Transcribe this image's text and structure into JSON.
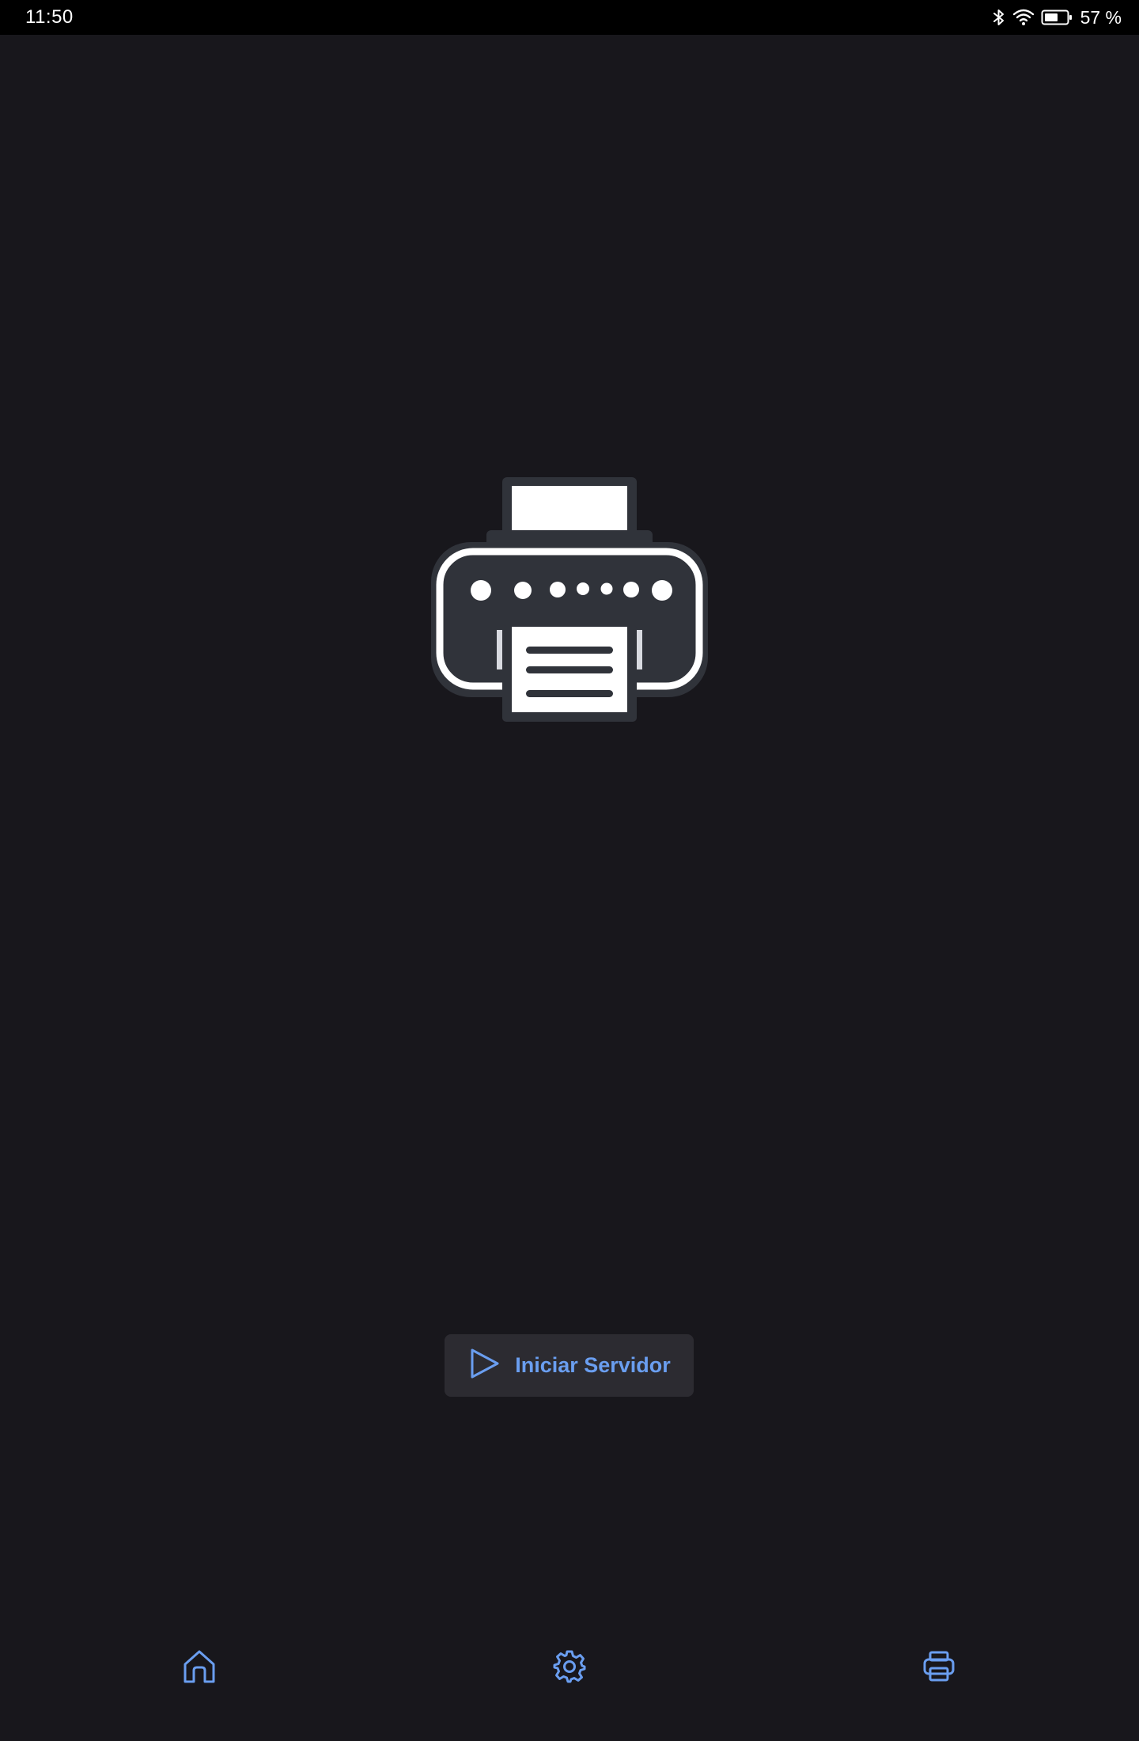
{
  "status_bar": {
    "time": "11:50",
    "battery": "57 %",
    "icons": [
      "bluetooth-icon",
      "wifi-icon",
      "battery-icon"
    ]
  },
  "hero": {
    "icon": "printer-illustration"
  },
  "main": {
    "start_button": {
      "label": "Iniciar Servidor",
      "icon": "play-icon"
    }
  },
  "bottom_nav": {
    "items": [
      {
        "icon": "home-icon"
      },
      {
        "icon": "gear-icon"
      },
      {
        "icon": "printer-icon"
      }
    ]
  },
  "colors": {
    "background": "#18171c",
    "status_bar": "#000000",
    "accent": "#6a9ef0",
    "button_bg": "#2c2b31"
  }
}
